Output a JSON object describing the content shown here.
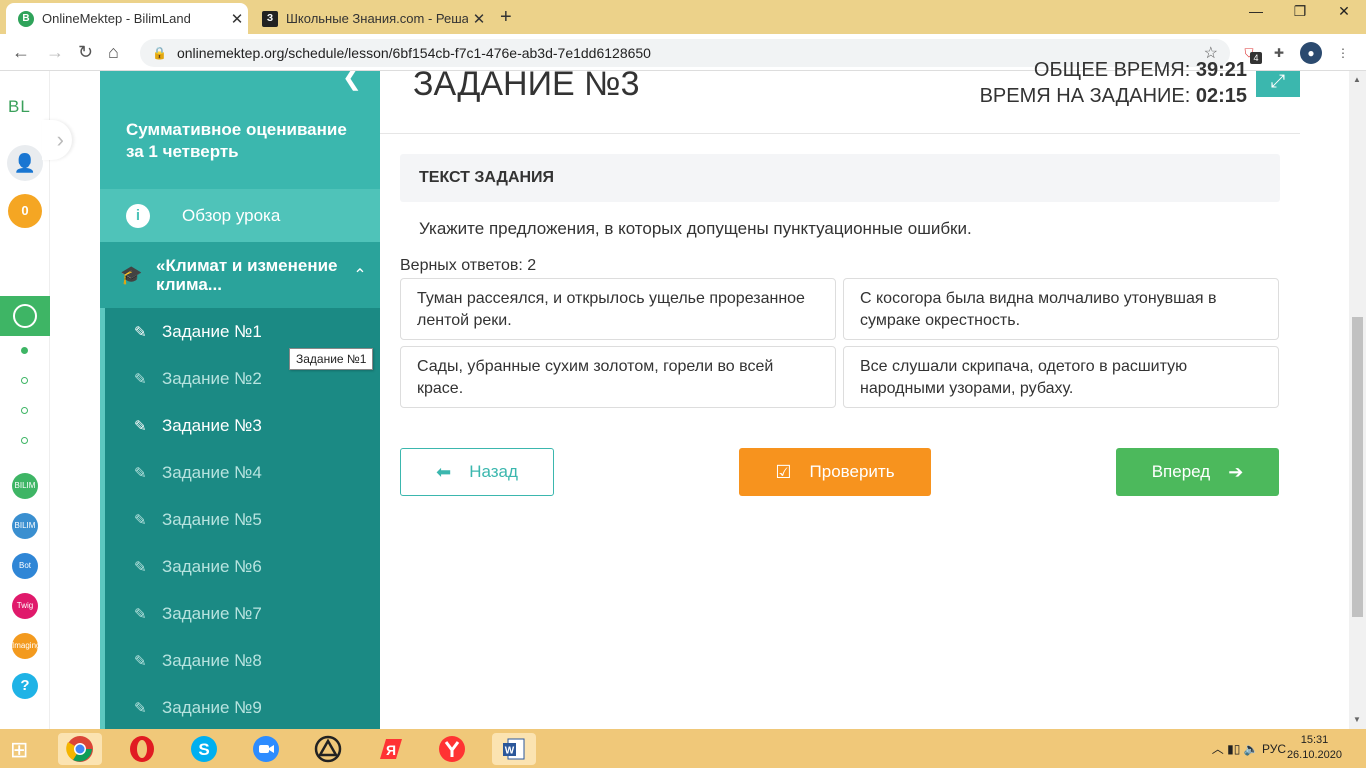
{
  "browser": {
    "tabs": [
      {
        "title": "OnlineMektep - BilimLand",
        "favicon": "B"
      },
      {
        "title": "Школьные Знания.com - Решае",
        "favicon": "З"
      }
    ],
    "url": "onlinemektep.org/schedule/lesson/6bf154cb-f7c1-476e-ab3d-7e1dd6128650",
    "ext_badge": "4"
  },
  "rail": {
    "logo": "BL",
    "coins": "0",
    "apps": [
      "BILIM Land",
      "BILIM Book",
      "Bot",
      "Twig",
      "Imaging",
      "?"
    ]
  },
  "sidebar": {
    "title": "Суммативное оценивание за 1 четверть",
    "overview": "Обзор урока",
    "topic": "«Климат и изменение клима...",
    "tasks": [
      {
        "label": "Задание №1",
        "state": "done"
      },
      {
        "label": "Задание №2",
        "state": "todo"
      },
      {
        "label": "Задание №3",
        "state": "current"
      },
      {
        "label": "Задание №4",
        "state": "todo"
      },
      {
        "label": "Задание №5",
        "state": "todo"
      },
      {
        "label": "Задание №6",
        "state": "todo"
      },
      {
        "label": "Задание №7",
        "state": "todo"
      },
      {
        "label": "Задание №8",
        "state": "todo"
      },
      {
        "label": "Задание №9",
        "state": "todo"
      }
    ],
    "tooltip": "Задание №1"
  },
  "main": {
    "task_title": "ЗАДАНИЕ №3",
    "total_time_label": "ОБЩЕЕ ВРЕМЯ:",
    "total_time": "39:21",
    "task_time_label": "ВРЕМЯ НА ЗАДАНИЕ:",
    "task_time": "02:15",
    "text_header": "ТЕКСТ ЗАДАНИЯ",
    "question": "Укажите предложения, в которых допущены пунктуационные ошибки.",
    "correct_count": "Верных ответов: 2",
    "options": [
      "Туман рассеялся, и открылось ущелье прорезанное лентой реки.",
      "С косогора была видна молчаливо утонувшая в сумраке окрестность.",
      "Сады, убранные сухим золотом, горели во всей красе.",
      "Все слушали скрипача, одетого в расшитую народными узорами, рубаху."
    ],
    "back_label": "Назад",
    "check_label": "Проверить",
    "next_label": "Вперед"
  },
  "taskbar": {
    "lang": "РУС",
    "time": "15:31",
    "date": "26.10.2020"
  }
}
